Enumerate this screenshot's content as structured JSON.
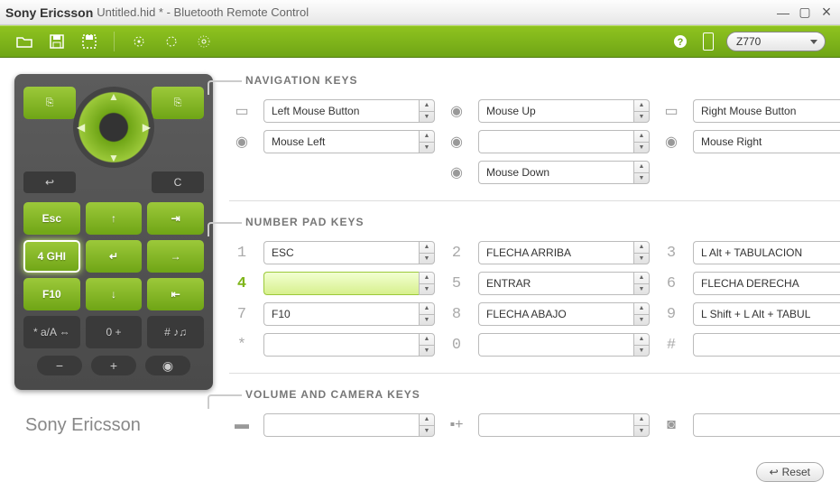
{
  "title": {
    "brand": "Sony Ericsson",
    "doc": "Untitled.hid * - Bluetooth Remote Control"
  },
  "toolbar": {
    "model": "Z770"
  },
  "sections": {
    "nav": "NAVIGATION KEYS",
    "num": "NUMBER PAD KEYS",
    "vol": "VOLUME AND CAMERA KEYS"
  },
  "nav": {
    "softLeft": "Left Mouse Button",
    "up": "Mouse Up",
    "softRight": "Right Mouse Button",
    "left": "Mouse Left",
    "center": "",
    "right": "Mouse Right",
    "down": "Mouse Down"
  },
  "numKeys": {
    "k1": {
      "label": "1",
      "val": "ESC"
    },
    "k2": {
      "label": "2",
      "val": "FLECHA ARRIBA"
    },
    "k3": {
      "label": "3",
      "val": "L Alt + TABULACION"
    },
    "k4": {
      "label": "4",
      "val": ""
    },
    "k5": {
      "label": "5",
      "val": "ENTRAR"
    },
    "k6": {
      "label": "6",
      "val": "FLECHA DERECHA"
    },
    "k7": {
      "label": "7",
      "val": "F10"
    },
    "k8": {
      "label": "8",
      "val": "FLECHA ABAJO"
    },
    "k9": {
      "label": "9",
      "val": "L Shift + L Alt + TABUL"
    },
    "kstar": {
      "label": "*",
      "val": ""
    },
    "k0": {
      "label": "0",
      "val": ""
    },
    "khash": {
      "label": "#",
      "val": ""
    }
  },
  "vol": {
    "minus": "",
    "plus": "",
    "cam": ""
  },
  "phoneKeys": {
    "r1": [
      "Esc",
      "↑",
      ""
    ],
    "r2": [
      "4  GHI",
      "",
      "→"
    ],
    "r3": [
      "F10",
      "↓",
      ""
    ],
    "r4": [
      "*  a/A ⇔",
      "0  +",
      "#  ♪♫"
    ]
  },
  "footer": {
    "reset": "Reset",
    "logo": "Sony Ericsson"
  }
}
